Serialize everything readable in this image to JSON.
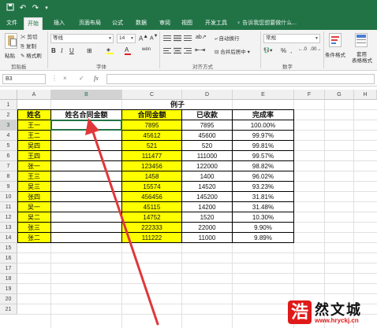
{
  "titlebar": {
    "save_icon": "save-icon",
    "undo_icon": "undo-icon",
    "redo_icon": "redo-icon",
    "customize_icon": "customize-quick-access-icon"
  },
  "tabs": [
    "文件",
    "开始",
    "插入",
    "页面布局",
    "公式",
    "数据",
    "审阅",
    "视图",
    "开发工具"
  ],
  "active_tab": "开始",
  "tell_me": "告诉我您想要做什么...",
  "ribbon": {
    "clipboard": {
      "paste": "粘贴",
      "cut": "剪切",
      "copy": "复制",
      "format_painter": "格式刷",
      "group_label": "剪贴板"
    },
    "font": {
      "name": "等线",
      "size": "14",
      "bold": "B",
      "italic": "I",
      "underline": "U",
      "wen": "wén",
      "group_label": "字体"
    },
    "alignment": {
      "wrap": "自动换行",
      "merge": "合并后居中",
      "group_label": "对齐方式"
    },
    "number": {
      "format": "常规",
      "percent": "%",
      "comma": ",",
      "group_label": "数字"
    },
    "styles": {
      "conditional": "条件格式",
      "table_format_1": "套用",
      "table_format_2": "表格格式"
    }
  },
  "formula_bar": {
    "name_box": "B3",
    "cancel": "×",
    "enter": "✓",
    "fx": "fx",
    "value": ""
  },
  "columns": [
    "A",
    "B",
    "C",
    "D",
    "E",
    "F",
    "G",
    "H"
  ],
  "rows": [
    "1",
    "2",
    "3",
    "4",
    "5",
    "6",
    "7",
    "8",
    "9",
    "10",
    "11",
    "12",
    "13",
    "14",
    "15",
    "16",
    "17",
    "18",
    "19",
    "20",
    "21"
  ],
  "sheet": {
    "title": "例子",
    "headers": [
      "姓名",
      "姓名合同金额",
      "合同金额",
      "已收款",
      "完成率"
    ],
    "data": [
      [
        "王一",
        "",
        "7895",
        "7895",
        "100.00%"
      ],
      [
        "王二",
        "",
        "45612",
        "45600",
        "99.97%"
      ],
      [
        "吴四",
        "",
        "521",
        "520",
        "99.81%"
      ],
      [
        "王四",
        "",
        "111477",
        "111000",
        "99.57%"
      ],
      [
        "张一",
        "",
        "123456",
        "122000",
        "98.82%"
      ],
      [
        "王三",
        "",
        "1458",
        "1400",
        "96.02%"
      ],
      [
        "吴三",
        "",
        "15574",
        "14520",
        "93.23%"
      ],
      [
        "张四",
        "",
        "456456",
        "145200",
        "31.81%"
      ],
      [
        "吴一",
        "",
        "45115",
        "14200",
        "31.48%"
      ],
      [
        "吴二",
        "",
        "14752",
        "1520",
        "10.30%"
      ],
      [
        "张三",
        "",
        "222333",
        "22000",
        "9.90%"
      ],
      [
        "张二",
        "",
        "111222",
        "11000",
        "9.89%"
      ]
    ]
  },
  "watermark": {
    "logo_char": "浩",
    "name": "然文城",
    "url": "www.hryckj.cn"
  },
  "colors": {
    "excel_green": "#217346",
    "highlight_yellow": "#ffff00",
    "arrow_red": "#e0383a"
  }
}
